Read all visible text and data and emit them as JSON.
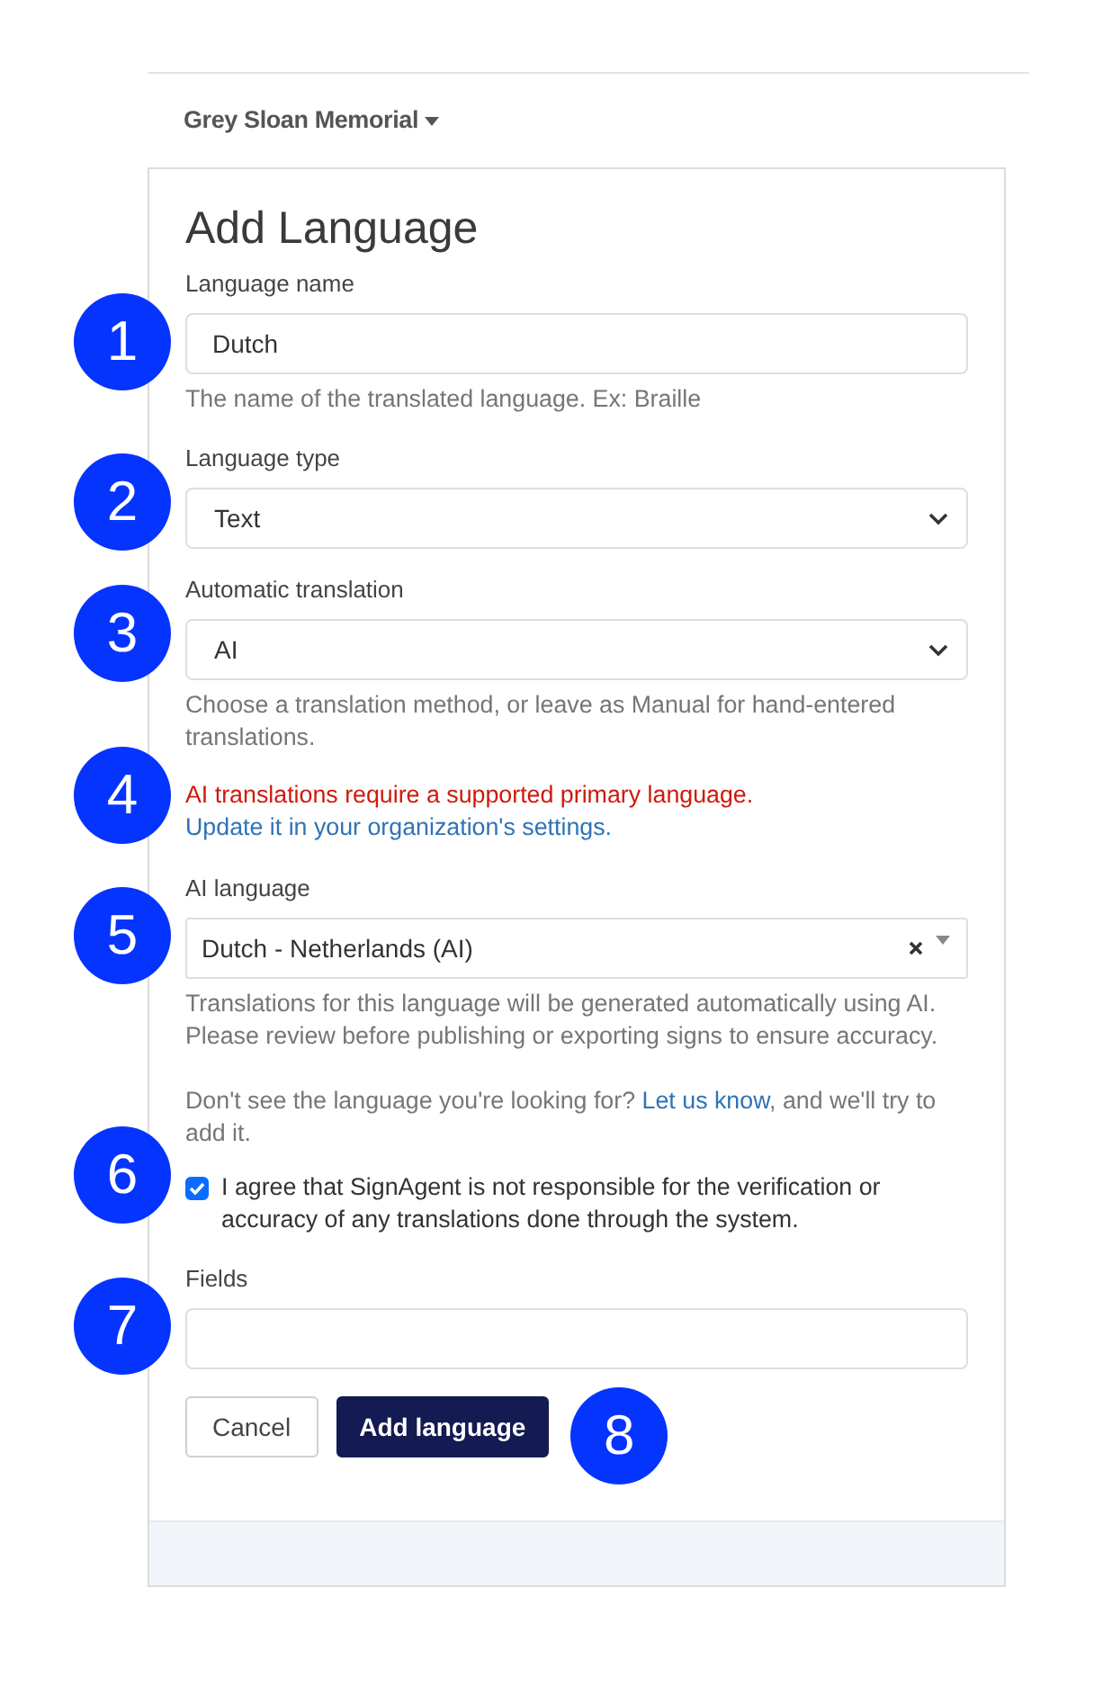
{
  "header": {
    "organization": "Grey Sloan Memorial"
  },
  "form": {
    "title": "Add Language",
    "groups": [
      {
        "kind": "input",
        "marker": "1",
        "label": "Language name",
        "value": "Dutch",
        "help": "The name of the translated language. Ex: Braille"
      },
      {
        "kind": "select",
        "marker": "2",
        "label": "Language type",
        "value": "Text"
      },
      {
        "kind": "select",
        "marker": "3",
        "label": "Automatic translation",
        "value": "AI",
        "help": "Choose a translation method, or leave as Manual for hand-entered translations."
      },
      {
        "kind": "warning",
        "marker": "4",
        "text": "AI translations require a supported primary language.",
        "link": "Update it in your organization's settings."
      },
      {
        "kind": "combobox",
        "marker": "5",
        "label": "AI language",
        "value": "Dutch - Netherlands (AI)",
        "help": "Translations for this language will be generated automatically using AI. Please review before publishing or exporting signs to ensure accuracy."
      },
      {
        "kind": "note",
        "text": "Don't see the language you're looking for?",
        "link": "Let us know",
        "text_after": ", and we'll try to add it."
      },
      {
        "kind": "checkbox",
        "marker": "6",
        "label": "I agree that SignAgent is not responsible for the verification or accuracy of any translations done through the system.",
        "checked": true
      },
      {
        "kind": "input",
        "marker": "7",
        "label": "Fields"
      }
    ],
    "buttons": [
      {
        "kind": "secondary",
        "label": "Cancel"
      },
      {
        "kind": "primary",
        "label": "Add language",
        "marker": "8"
      }
    ]
  }
}
